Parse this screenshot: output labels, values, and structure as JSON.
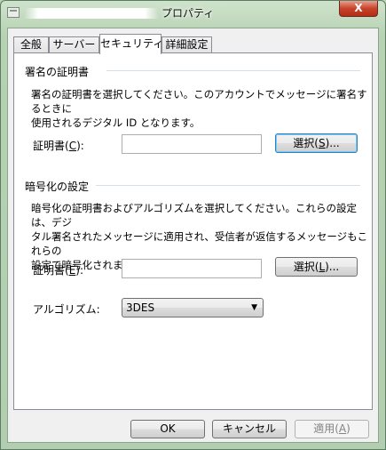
{
  "window": {
    "title": "プロパティ",
    "close_label": "X"
  },
  "tabs": [
    {
      "label": "全般",
      "active": false
    },
    {
      "label": "サーバー",
      "active": false
    },
    {
      "label": "セキュリティ",
      "active": true
    },
    {
      "label": "詳細設定",
      "active": false
    }
  ],
  "signing": {
    "heading": "署名の証明書",
    "desc_line1": "署名の証明書を選択してください。このアカウントでメッセージに署名するときに",
    "desc_line2": "使用されるデジタル ID となります。",
    "cert_label_prefix": "証明書(",
    "cert_label_key": "C",
    "cert_label_suffix": "):",
    "cert_value": "",
    "select_prefix": "選択(",
    "select_key": "S",
    "select_suffix": ")..."
  },
  "encryption": {
    "heading": "暗号化の設定",
    "desc_line1": "暗号化の証明書およびアルゴリズムを選択してください。これらの設定は、デジ",
    "desc_line2": "タル署名されたメッセージに適用され、受信者が返信するメッセージもこれらの",
    "desc_line3": "設定で暗号化されます。",
    "cert_label_prefix": "証明書(",
    "cert_label_key": "E",
    "cert_label_suffix": "):",
    "cert_value": "",
    "select_prefix": "選択(",
    "select_key": "L",
    "select_suffix": ")...",
    "algorithm_label": "アルゴリズム:",
    "algorithm_value": "3DES"
  },
  "footer": {
    "ok_label": "OK",
    "cancel_label": "キャンセル",
    "apply_prefix": "適用(",
    "apply_key": "A",
    "apply_suffix": ")"
  }
}
